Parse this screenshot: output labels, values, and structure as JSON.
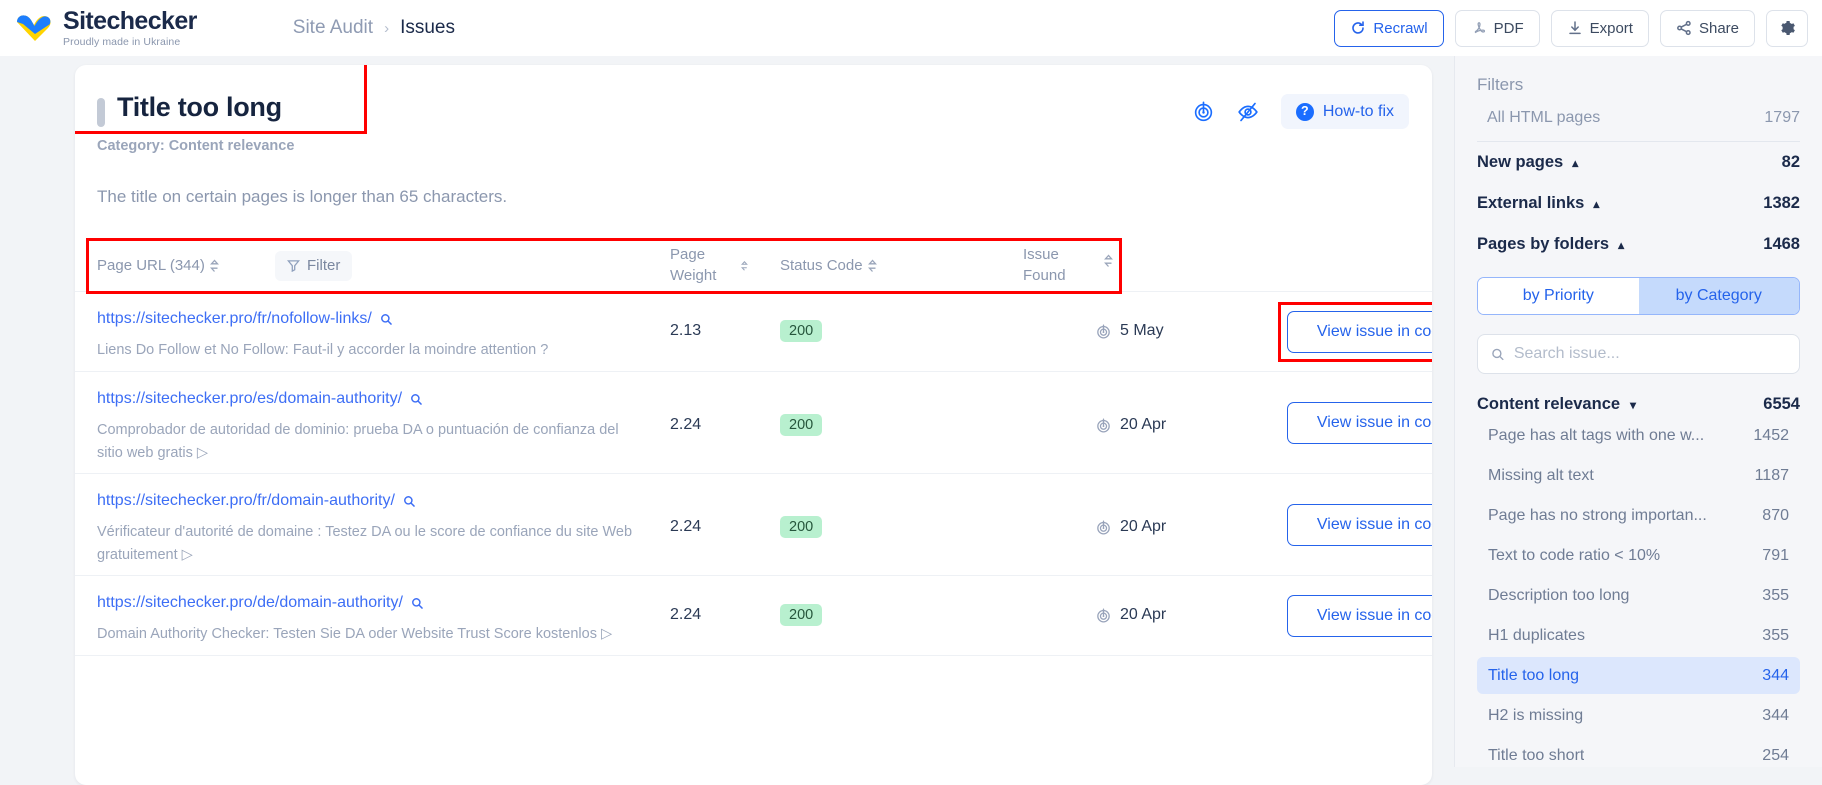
{
  "brand": {
    "name": "Sitechecker",
    "tagline": "Proudly made in Ukraine"
  },
  "breadcrumb": {
    "parent": "Site Audit",
    "separator": "›",
    "current": "Issues"
  },
  "toolbar": {
    "recrawl": "Recrawl",
    "pdf": "PDF",
    "export": "Export",
    "share": "Share",
    "settings_icon": "gear-icon"
  },
  "issue": {
    "title": "Title too long",
    "category": "Category: Content relevance",
    "description": "The title on certain pages is longer than 65 characters.",
    "how_to_fix": "How-to fix"
  },
  "table": {
    "headers": {
      "url": "Page URL (344)",
      "filter": "Filter",
      "weight": "Page Weight",
      "status": "Status Code",
      "found": "Issue Found"
    },
    "action_label": "View issue in code",
    "rows": [
      {
        "url": "https://sitechecker.pro/fr/nofollow-links/",
        "desc": "Liens Do Follow et No Follow: Faut-il y accorder la moindre attention ?",
        "weight": "2.13",
        "status": "200",
        "found": "5 May"
      },
      {
        "url": "https://sitechecker.pro/es/domain-authority/",
        "desc": "Comprobador de autoridad de dominio: prueba DA o puntuación de confianza del sitio web gratis ▷",
        "weight": "2.24",
        "status": "200",
        "found": "20 Apr"
      },
      {
        "url": "https://sitechecker.pro/fr/domain-authority/",
        "desc": "Vérificateur d'autorité de domaine : Testez DA ou le score de confiance du site Web gratuitement ▷",
        "weight": "2.24",
        "status": "200",
        "found": "20 Apr"
      },
      {
        "url": "https://sitechecker.pro/de/domain-authority/",
        "desc": "Domain Authority Checker: Testen Sie DA oder Website Trust Score kostenlos ▷",
        "weight": "2.24",
        "status": "200",
        "found": "20 Apr"
      }
    ]
  },
  "sidebar": {
    "title": "Filters",
    "all_html": {
      "label": "All HTML pages",
      "count": "1797"
    },
    "groups": [
      {
        "label": "New pages",
        "count": "82"
      },
      {
        "label": "External links",
        "count": "1382"
      },
      {
        "label": "Pages by folders",
        "count": "1468"
      }
    ],
    "segmented": {
      "priority": "by Priority",
      "category": "by Category",
      "active": "by Category"
    },
    "search_placeholder": "Search issue...",
    "category": {
      "label": "Content relevance",
      "count": "6554"
    },
    "issues": [
      {
        "name": "Page has alt tags with one w...",
        "count": "1452",
        "selected": false
      },
      {
        "name": "Missing alt text",
        "count": "1187",
        "selected": false
      },
      {
        "name": "Page has no strong importan...",
        "count": "870",
        "selected": false
      },
      {
        "name": "Text to code ratio < 10%",
        "count": "791",
        "selected": false
      },
      {
        "name": "Description too long",
        "count": "355",
        "selected": false
      },
      {
        "name": "H1 duplicates",
        "count": "355",
        "selected": false
      },
      {
        "name": "Title too long",
        "count": "344",
        "selected": true
      },
      {
        "name": "H2 is missing",
        "count": "344",
        "selected": false
      },
      {
        "name": "Title too short",
        "count": "254",
        "selected": false
      }
    ]
  },
  "colors": {
    "accent": "#2563eb",
    "annotation": "#ff0000",
    "status_ok_bg": "#b8f0cf",
    "title_dark": "#16243f"
  }
}
